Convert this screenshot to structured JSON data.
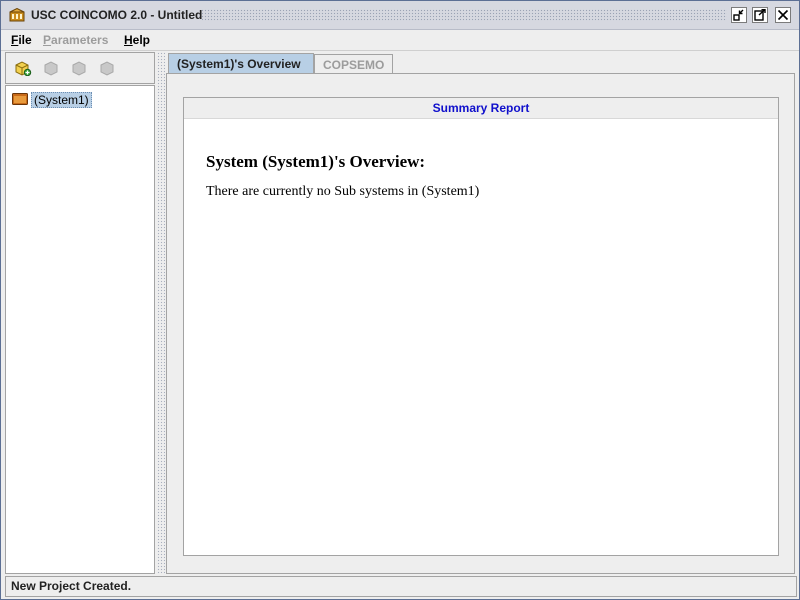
{
  "window": {
    "title": "USC COINCOMO 2.0 - Untitled"
  },
  "menubar": {
    "items": [
      {
        "label": "File",
        "mnemonic": "F",
        "rest": "ile",
        "enabled": true
      },
      {
        "label": "Parameters",
        "mnemonic": "P",
        "rest": "arameters",
        "enabled": false
      },
      {
        "label": "Help",
        "mnemonic": "H",
        "rest": "elp",
        "enabled": true
      }
    ]
  },
  "toolbar": {
    "icons": [
      "add-system-icon",
      "component-icon",
      "sub-component-icon",
      "module-icon"
    ]
  },
  "tree": {
    "root_label": "(System1)",
    "root_icon": "folder-icon"
  },
  "tabs": [
    {
      "label": "(System1)'s Overview",
      "active": true
    },
    {
      "label": "COPSEMO",
      "active": false
    }
  ],
  "report": {
    "header": "Summary Report",
    "heading": "System (System1)'s Overview:",
    "text": "There are currently no Sub systems in (System1)"
  },
  "status": {
    "text": "New Project Created."
  },
  "colors": {
    "accent": "#b8cfe5",
    "report_title": "#1010cc"
  }
}
